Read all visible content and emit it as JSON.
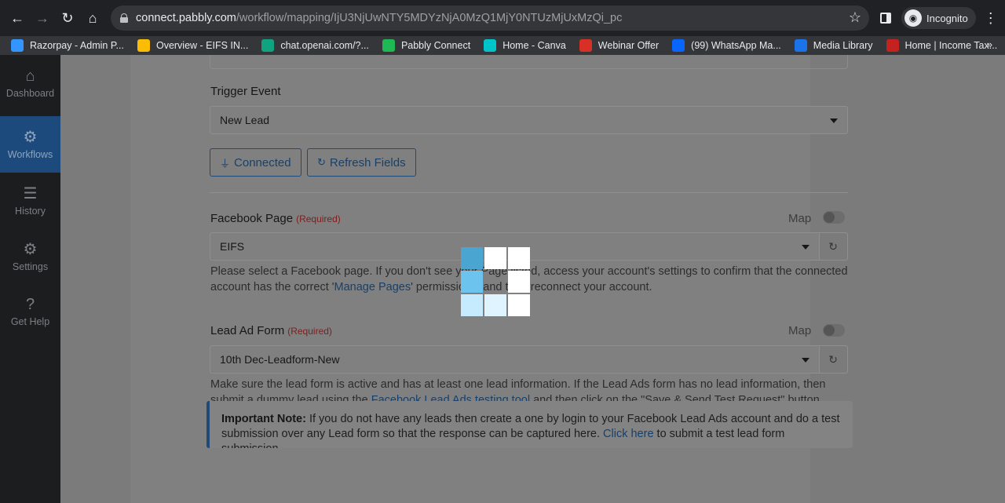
{
  "browser": {
    "url_host": "connect.pabbly.com",
    "url_path": "/workflow/mapping/IjU3NjUwNTY5MDYzNjA0MzQ1MjY0NTUzMjUxMzQi_pc",
    "profile_label": "Incognito",
    "bookmarks": [
      {
        "label": "Razorpay - Admin P...",
        "icon": "razorpay-icon",
        "color": "#3395ff"
      },
      {
        "label": "Overview - EIFS IN...",
        "icon": "google-ads-icon",
        "color": "#fbbc04"
      },
      {
        "label": "chat.openai.com/?...",
        "icon": "openai-icon",
        "color": "#10a37f"
      },
      {
        "label": "Pabbly Connect",
        "icon": "pabbly-icon",
        "color": "#1eb955"
      },
      {
        "label": "Home - Canva",
        "icon": "canva-icon",
        "color": "#00c4cc"
      },
      {
        "label": "Webinar Offer",
        "icon": "webinar-icon",
        "color": "#d93025"
      },
      {
        "label": "(99) WhatsApp Ma...",
        "icon": "meta-icon",
        "color": "#0866ff"
      },
      {
        "label": "Media Library",
        "icon": "info-icon",
        "color": "#1a73e8"
      },
      {
        "label": "Home | Income Tax...",
        "icon": "income-tax-icon",
        "color": "#c5221f"
      }
    ],
    "more_label": "»"
  },
  "sidebar": {
    "items": [
      {
        "label": "Dashboard",
        "icon": "home-icon",
        "glyph": "⌂"
      },
      {
        "label": "Workflows",
        "icon": "workflows-icon",
        "glyph": "⚙"
      },
      {
        "label": "History",
        "icon": "history-icon",
        "glyph": "☰"
      },
      {
        "label": "Settings",
        "icon": "gear-icon",
        "glyph": "⚙"
      },
      {
        "label": "Get Help",
        "icon": "help-icon",
        "glyph": "?"
      }
    ]
  },
  "form": {
    "trigger_label": "Trigger Event",
    "trigger_value": "New Lead",
    "connected_label": "Connected",
    "refresh_label": "Refresh Fields",
    "facebook_page": {
      "label": "Facebook Page",
      "required": "(Required)",
      "map_label": "Map",
      "value": "EIFS",
      "help_before": "Please select a Facebook page. If you don't see your Page listed, access your account's settings to confirm that the connected account has the correct '",
      "help_link": "Manage Pages",
      "help_after": "' permissions, and then reconnect your account."
    },
    "lead_form": {
      "label": "Lead Ad Form",
      "required": "(Required)",
      "map_label": "Map",
      "value": "10th Dec-Leadform-New",
      "help_before": "Make sure the lead form is active and has at least one lead information. If the Lead Ads form has no lead information, then submit a dummy lead using the ",
      "help_link": "Facebook Lead Ads testing tool",
      "help_after": " and then click on the \"Save & Send Test Request\" button."
    },
    "note": {
      "title": "Important Note:",
      "text": " If you do not have any leads then create a one by login to your Facebook Lead Ads account and do a test submission over any Lead form so that the response can be captured here. ",
      "link": "Click here",
      "text_after": " to submit a test lead form submission"
    }
  },
  "colors": {
    "loader_dark": "#4aa5d0",
    "loader_mid": "#6cc3ee",
    "loader_light": "#c6ebff",
    "loader_pale": "#e0f4ff",
    "loader_white": "#ffffff"
  }
}
